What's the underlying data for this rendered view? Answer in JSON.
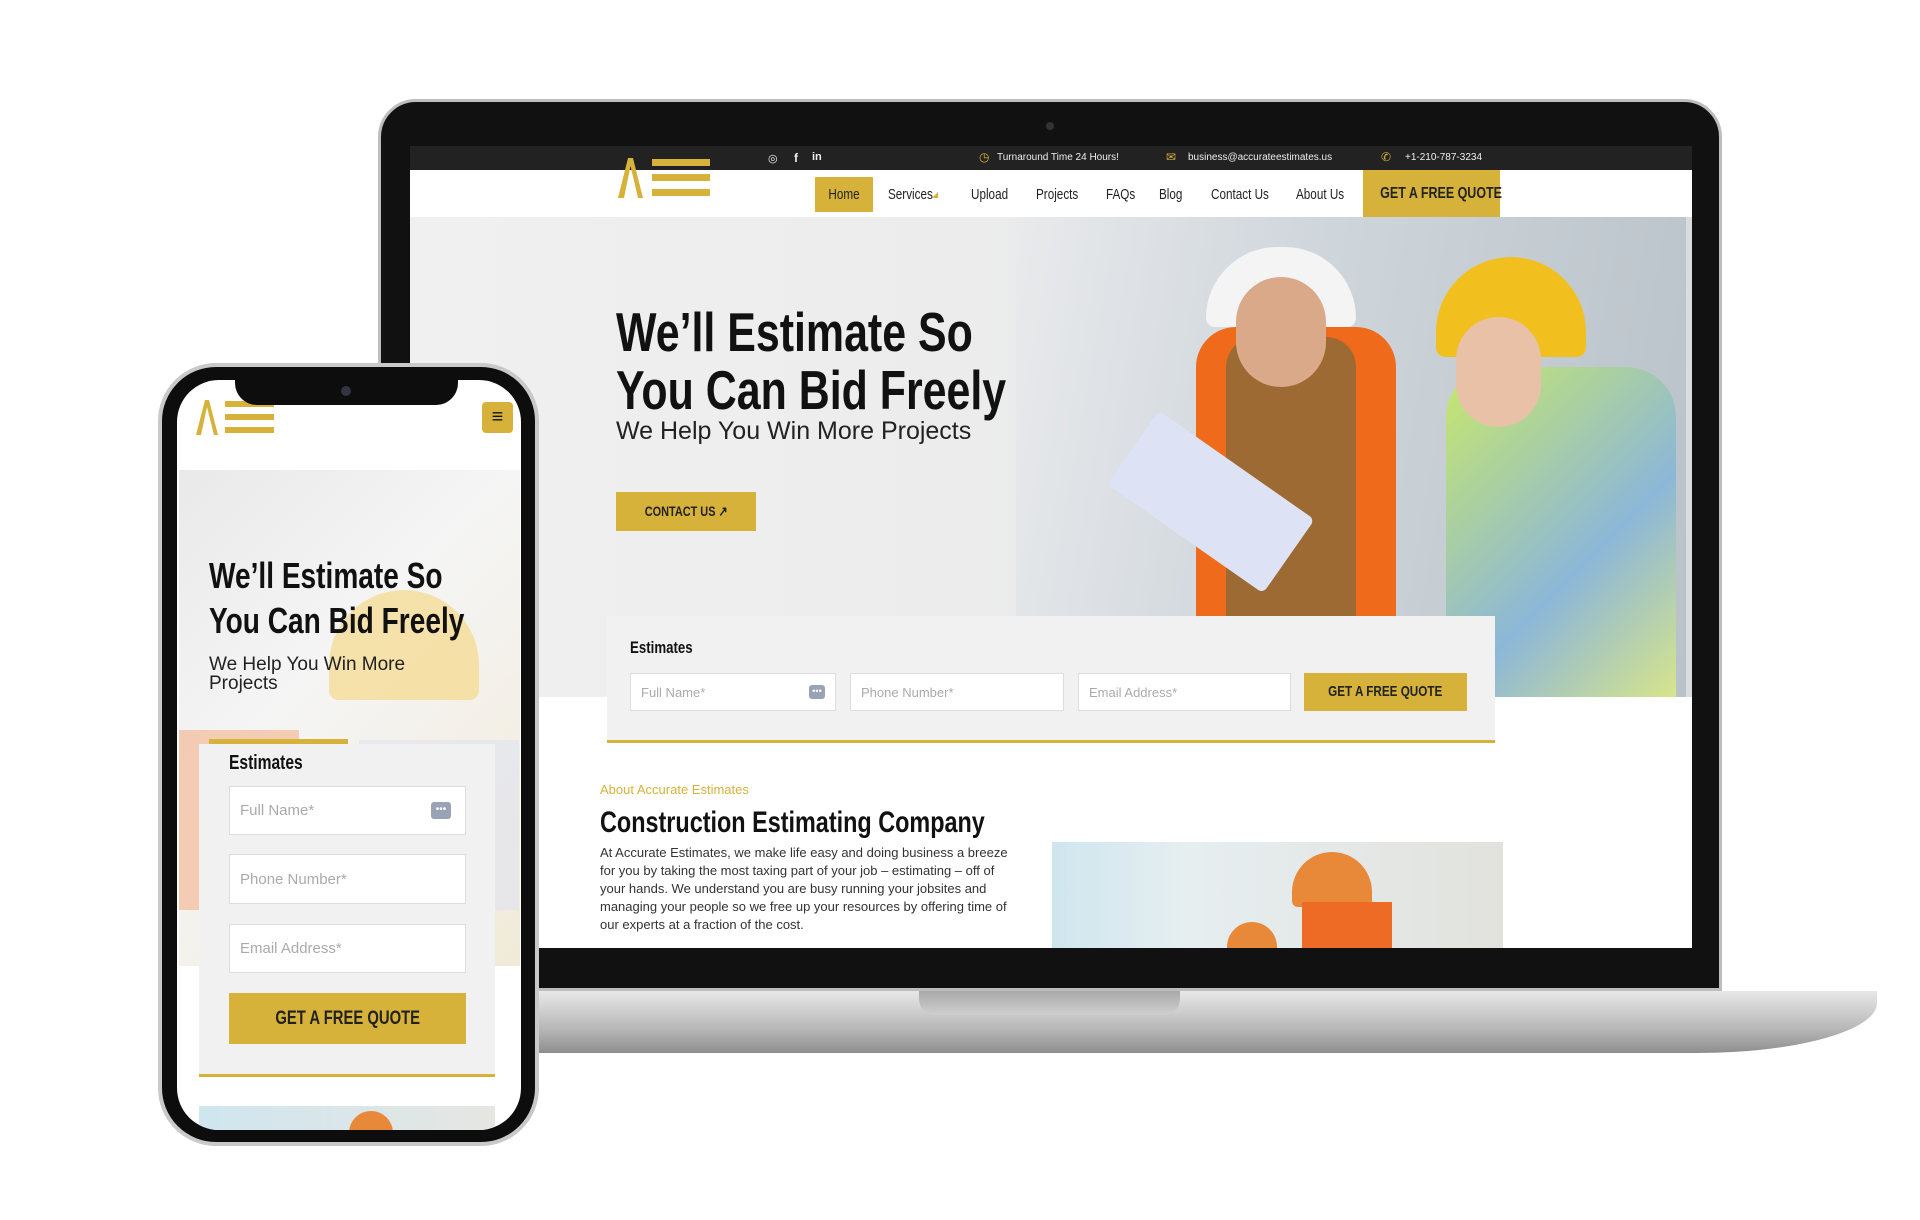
{
  "brand": {
    "logo": "AE",
    "accent": "#d6b23a",
    "dark": "#222222"
  },
  "topbar": {
    "social": [
      "instagram-icon",
      "facebook-icon",
      "linkedin-icon"
    ],
    "turnaround": "Turnaround Time 24 Hours!",
    "email": "business@accurateestimates.us",
    "phone": "+1-210-787-3234"
  },
  "nav": {
    "items": [
      {
        "label": "Home",
        "active": true
      },
      {
        "label": "Services",
        "dropdown": true
      },
      {
        "label": "Upload"
      },
      {
        "label": "Projects"
      },
      {
        "label": "FAQs"
      },
      {
        "label": "Blog"
      },
      {
        "label": "Contact Us"
      },
      {
        "label": "About Us"
      }
    ],
    "cta": "GET A FREE QUOTE"
  },
  "hero": {
    "title_line1": "We’ll Estimate So",
    "title_line2": "You Can Bid Freely",
    "subtitle": "We Help You Win More Projects",
    "subtitle_line1": "We Help You Win More",
    "subtitle_line2": "Projects",
    "button": "CONTACT US ↗"
  },
  "estimates": {
    "title": "Estimates",
    "full_name": "Full Name*",
    "phone": "Phone Number*",
    "email": "Email Address*",
    "button": "GET A FREE QUOTE"
  },
  "about": {
    "eyebrow": "About Accurate Estimates",
    "heading": "Construction Estimating Company",
    "body": "At Accurate Estimates, we make life easy and doing business a breeze for you by taking the most taxing part of your job – estimating – off of your hands. We understand you are busy running your jobsites and managing your people so we free up your resources by offering time of our experts at a fraction of the cost."
  }
}
